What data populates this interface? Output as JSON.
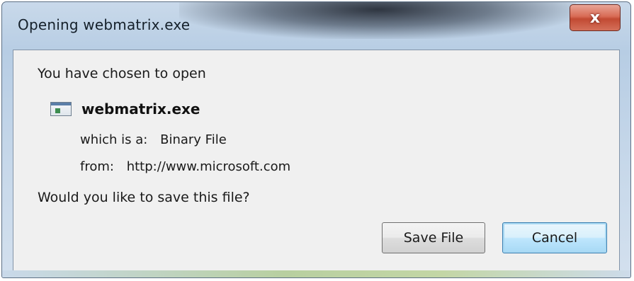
{
  "window": {
    "title": "Opening webmatrix.exe",
    "close_symbol": "x"
  },
  "dialog": {
    "heading": "You have chosen to open",
    "file_name": "webmatrix.exe",
    "file_icon": "executable-file-icon",
    "type_label": "which is a:",
    "type_value": "Binary File",
    "from_label": "from:",
    "from_value": "http://www.microsoft.com",
    "question": "Would you like to save this file?"
  },
  "buttons": {
    "save_label": "Save File",
    "cancel_label": "Cancel"
  },
  "colors": {
    "close_button": "#d86b55",
    "default_button": "#bee6fd",
    "client_bg": "#f0f0f0"
  }
}
